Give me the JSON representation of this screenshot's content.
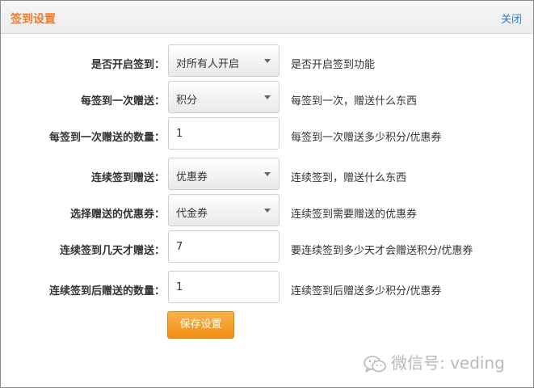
{
  "dialog": {
    "title": "签到设置",
    "close_label": "关闭"
  },
  "form": {
    "rows": [
      {
        "label": "是否开启签到：",
        "type": "select",
        "value": "对所有人开启",
        "hint": "是否开启签到功能"
      },
      {
        "label": "每签到一次赠送：",
        "type": "select",
        "value": "积分",
        "hint": "每签到一次，赠送什么东西"
      },
      {
        "label": "每签到一次赠送的数量：",
        "type": "input",
        "value": "1",
        "hint": "每签到一次赠送多少积分/优惠券"
      },
      {
        "label": "连续签到赠送：",
        "type": "select",
        "value": "优惠券",
        "hint": "连续签到，赠送什么东西"
      },
      {
        "label": "选择赠送的优惠券：",
        "type": "select",
        "value": "代金券",
        "hint": "连续签到需要赠送的优惠券"
      },
      {
        "label": "连续签到几天才赠送：",
        "type": "input",
        "value": "7",
        "hint": "要连续签到多少天才会赠送积分/优惠券"
      },
      {
        "label": "连续签到后赠送的数量：",
        "type": "input",
        "value": "1",
        "hint": "连续签到后赠送多少积分/优惠券"
      }
    ],
    "save_label": "保存设置"
  },
  "watermark": {
    "text": "微信号: veding",
    "icon": "wechat-logo-icon"
  }
}
